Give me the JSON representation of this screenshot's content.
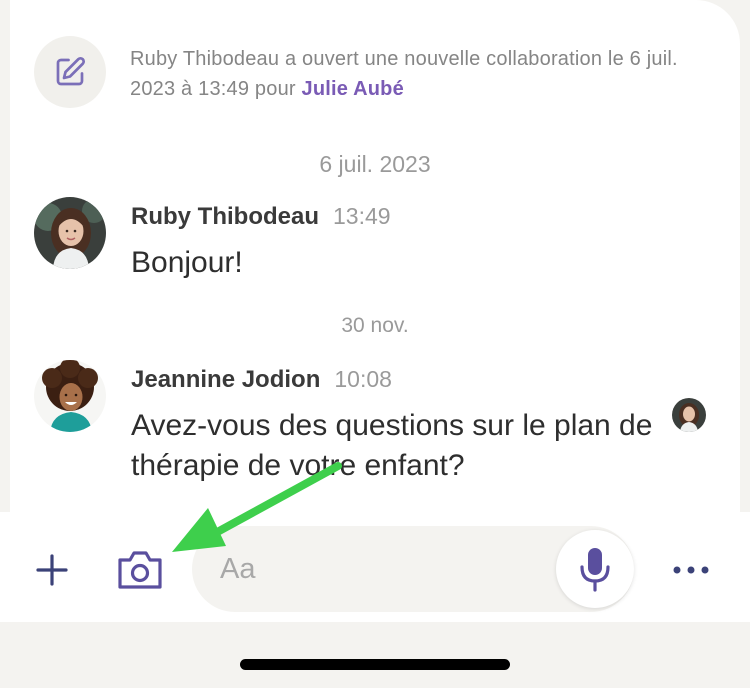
{
  "system_event": {
    "text": "Ruby Thibodeau a ouvert une nouvelle collaboration le 6 juil. 2023 à 13:49 pour ",
    "mention": "Julie Aubé",
    "icon": "edit-note-icon"
  },
  "messages": [
    {
      "date_separator": "6 juil. 2023",
      "author": "Ruby Thibodeau",
      "time": "13:49",
      "body": "Bonjour!"
    },
    {
      "date_separator": "30 nov.",
      "author": "Jeannine Jodion",
      "time": "10:08",
      "body": "Avez-vous des questions sur le plan de thérapie de votre enfant?"
    }
  ],
  "composer": {
    "placeholder": "Aa",
    "icons": [
      "plus-icon",
      "camera-icon",
      "microphone-icon",
      "more-icon"
    ]
  },
  "colors": {
    "accent": "#5a4f9e",
    "mention": "#7a5bb5",
    "annotation_arrow": "#3ecf4c"
  }
}
